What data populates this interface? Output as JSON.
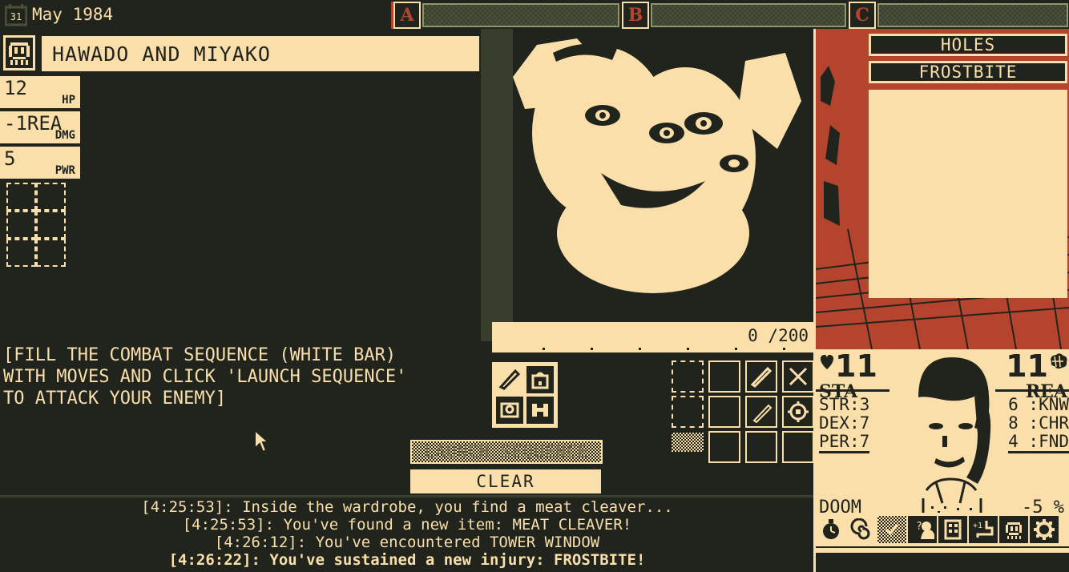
{
  "theme": {
    "background": "#21241c",
    "cream": "#fadfab",
    "red": "#b5442f",
    "olive": "#4a5038"
  },
  "topbar": {
    "calendar_day": "31",
    "date": "May 1984",
    "slots": [
      {
        "letter": "A"
      },
      {
        "letter": "B"
      },
      {
        "letter": "C"
      }
    ]
  },
  "header": {
    "title": "HAWADO AND MIYAKO"
  },
  "left_stats": [
    {
      "value": "12",
      "label": "HP"
    },
    {
      "value": "-1REA",
      "label": "DMG"
    },
    {
      "value": "5",
      "label": "PWR"
    }
  ],
  "inventory": {
    "rows": 3,
    "cols": 2,
    "cells": [
      "",
      "",
      "",
      "",
      "",
      ""
    ]
  },
  "instructions": [
    "[FILL THE COMBAT SEQUENCE (WHITE BAR)",
    "WITH MOVES AND CLICK 'LAUNCH SEQUENCE'",
    "TO ATTACK YOUR ENEMY]"
  ],
  "sequence_bar": {
    "current": "0",
    "max": "200",
    "display": "0 /200"
  },
  "equipment": [
    {
      "icon": "cleaver-icon",
      "filled": true
    },
    {
      "icon": "backpack-icon",
      "filled": true
    },
    {
      "icon": "helmet-icon",
      "filled": true
    },
    {
      "icon": "boots-icon",
      "filled": true
    }
  ],
  "buttons": {
    "launch_label": "LAUNCH SEQUENCE",
    "launch_enabled": false,
    "clear_label": "CLEAR"
  },
  "move_grid": [
    {
      "icon": "empty-slot",
      "state": "empty"
    },
    {
      "icon": "grab-hand-icon",
      "state": "filled"
    },
    {
      "icon": "slash-blade-icon",
      "state": "filled"
    },
    {
      "icon": "cross-slash-icon",
      "state": "filled"
    },
    {
      "icon": "empty-slot",
      "state": "empty"
    },
    {
      "icon": "kneel-figure-icon",
      "state": "filled"
    },
    {
      "icon": "thrust-blade-icon",
      "state": "filled"
    },
    {
      "icon": "target-icon",
      "state": "filled"
    },
    {
      "icon": "dither-slot",
      "state": "dither"
    },
    {
      "icon": "blank-slot",
      "state": "blank"
    },
    {
      "icon": "heal-figure-icon",
      "state": "filled"
    },
    {
      "icon": "blank-slot",
      "state": "blank"
    }
  ],
  "injuries": [
    {
      "name": "HOLES"
    },
    {
      "name": "FROSTBITE"
    }
  ],
  "character": {
    "stamina": {
      "value": "11",
      "label": "STA",
      "icon": "heart-icon"
    },
    "reason": {
      "value": "11",
      "label": "REA",
      "icon": "brain-icon"
    },
    "attributes_left": [
      {
        "key": "STR",
        "value": "3"
      },
      {
        "key": "DEX",
        "value": "7"
      },
      {
        "key": "PER",
        "value": "7"
      }
    ],
    "attributes_right": [
      {
        "value": "6",
        "key": "KNW"
      },
      {
        "value": "8",
        "key": "CHR"
      },
      {
        "value": "4",
        "key": "FND"
      }
    ],
    "doom_label": "DOOM",
    "doom_value": "-5 %"
  },
  "toolbar_icons": [
    {
      "name": "pocketwatch-icon",
      "active": true
    },
    {
      "name": "spiral-icon",
      "active": true
    },
    {
      "name": "dither-icon",
      "active": true
    },
    {
      "name": "inquiry-icon",
      "active": false
    },
    {
      "name": "building-icon",
      "active": false
    },
    {
      "name": "levelup-icon",
      "active": false
    },
    {
      "name": "creature-icon",
      "active": false
    },
    {
      "name": "gear-icon",
      "active": false
    }
  ],
  "log": [
    {
      "text": "[4:25:53]: Inside the wardrobe, you find a meat cleaver...",
      "alert": false
    },
    {
      "text": "[4:25:53]: You've found a new item: MEAT CLEAVER!",
      "alert": false
    },
    {
      "text": "[4:26:12]: You've encountered TOWER WINDOW",
      "alert": false
    },
    {
      "text": "[4:26:22]: You've sustained a new injury: FROSTBITE!",
      "alert": true
    }
  ]
}
